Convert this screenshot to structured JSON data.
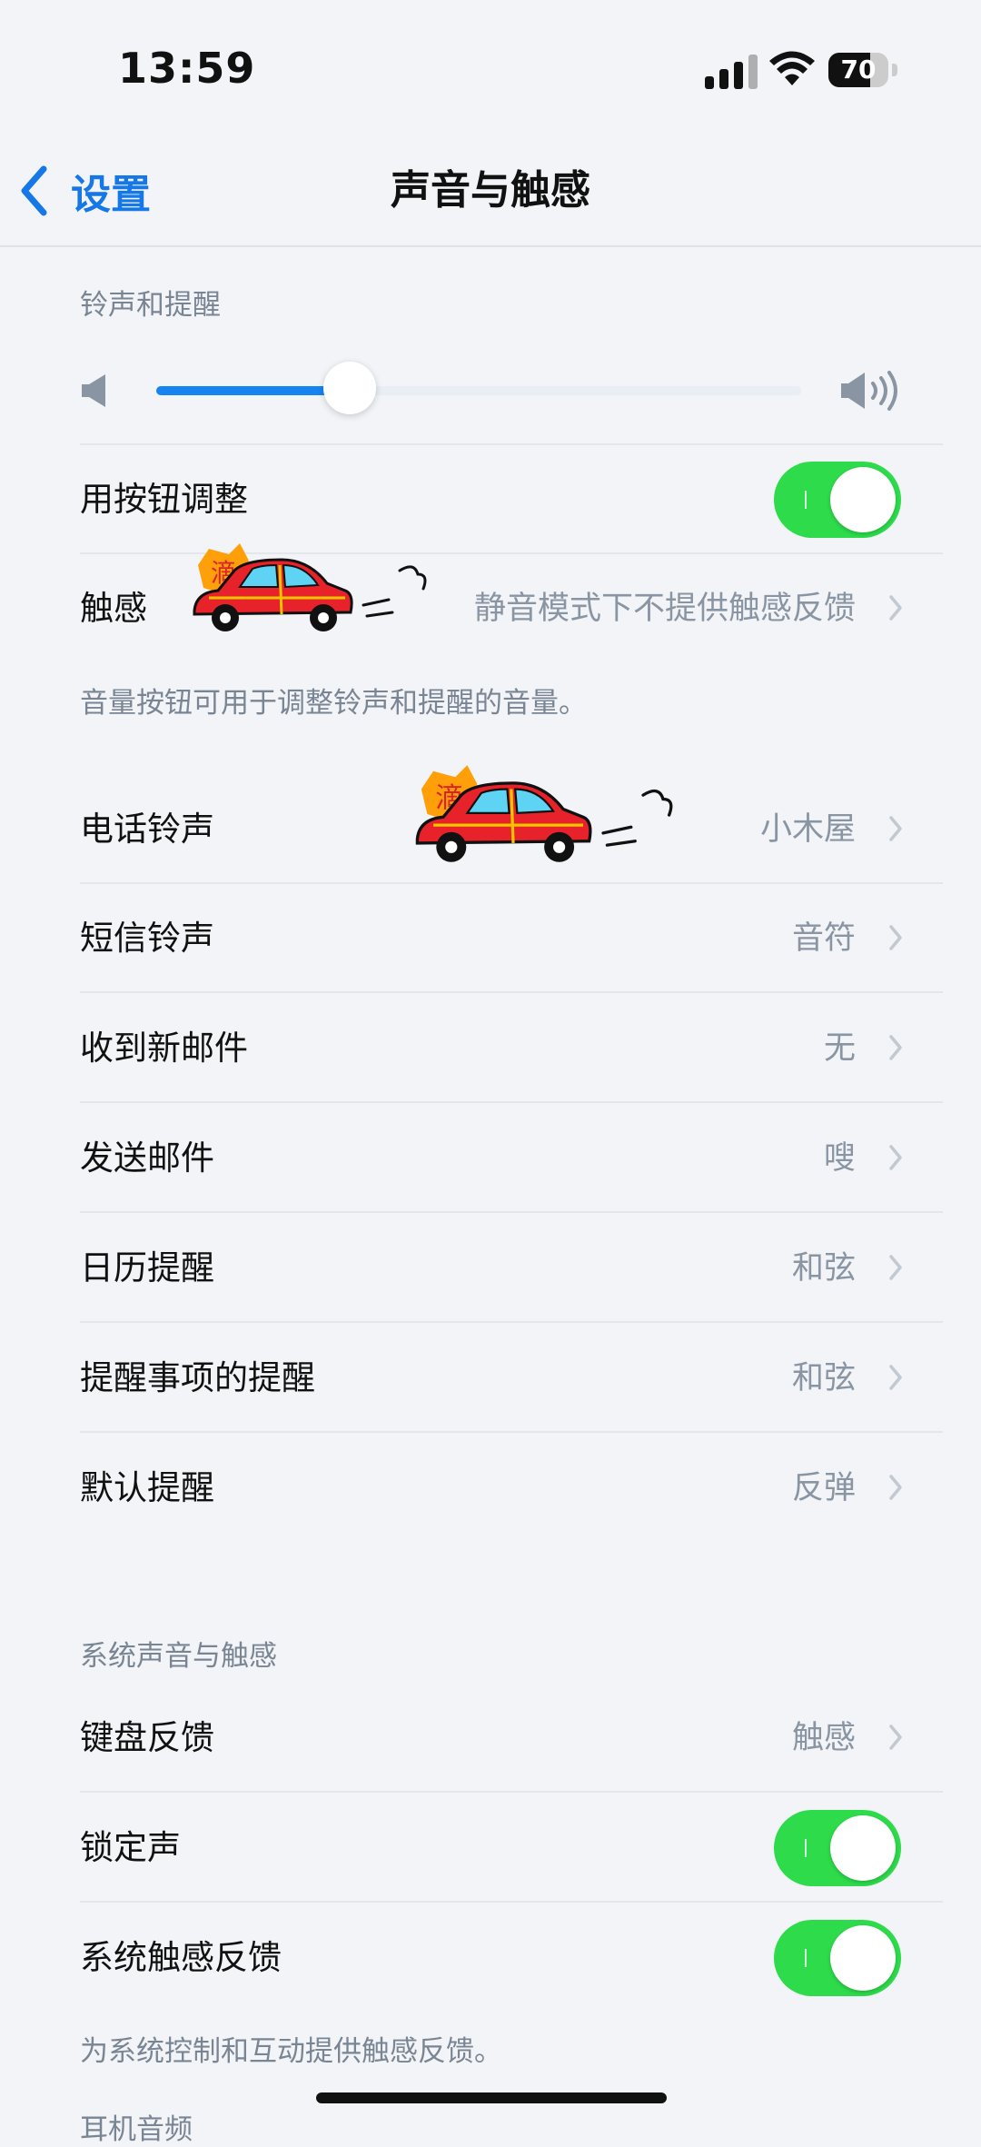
{
  "status_bar": {
    "time": "13:59",
    "battery": "70",
    "battery_level": 0.7
  },
  "nav": {
    "back_label": "设置",
    "title": "声音与触感"
  },
  "ringer_section": {
    "title": "铃声和提醒",
    "volume_level": 0.3,
    "adjust_with_buttons": {
      "label": "用按钮调整",
      "on": true
    },
    "haptics": {
      "label": "触感",
      "value": "静音模式下不提供触感反馈"
    },
    "footnote": "音量按钮可用于调整铃声和提醒的音量。"
  },
  "sounds": [
    {
      "label": "电话铃声",
      "value": "小木屋"
    },
    {
      "label": "短信铃声",
      "value": "音符"
    },
    {
      "label": "收到新邮件",
      "value": "无"
    },
    {
      "label": "发送邮件",
      "value": "嗖"
    },
    {
      "label": "日历提醒",
      "value": "和弦"
    },
    {
      "label": "提醒事项的提醒",
      "value": "和弦"
    },
    {
      "label": "默认提醒",
      "value": "反弹"
    }
  ],
  "system_section": {
    "title": "系统声音与触感",
    "keyboard_feedback": {
      "label": "键盘反馈",
      "value": "触感"
    },
    "lock_sound": {
      "label": "锁定声",
      "on": true
    },
    "system_haptics": {
      "label": "系统触感反馈",
      "on": true
    },
    "footnote": "为系统控制和互动提供触感反馈。",
    "next_title": "耳机音频"
  },
  "sticker_text": "滴",
  "colors": {
    "accent": "#1677e6",
    "toggle_on": "#2ddb4b",
    "slider_fill": "#1684f0"
  }
}
